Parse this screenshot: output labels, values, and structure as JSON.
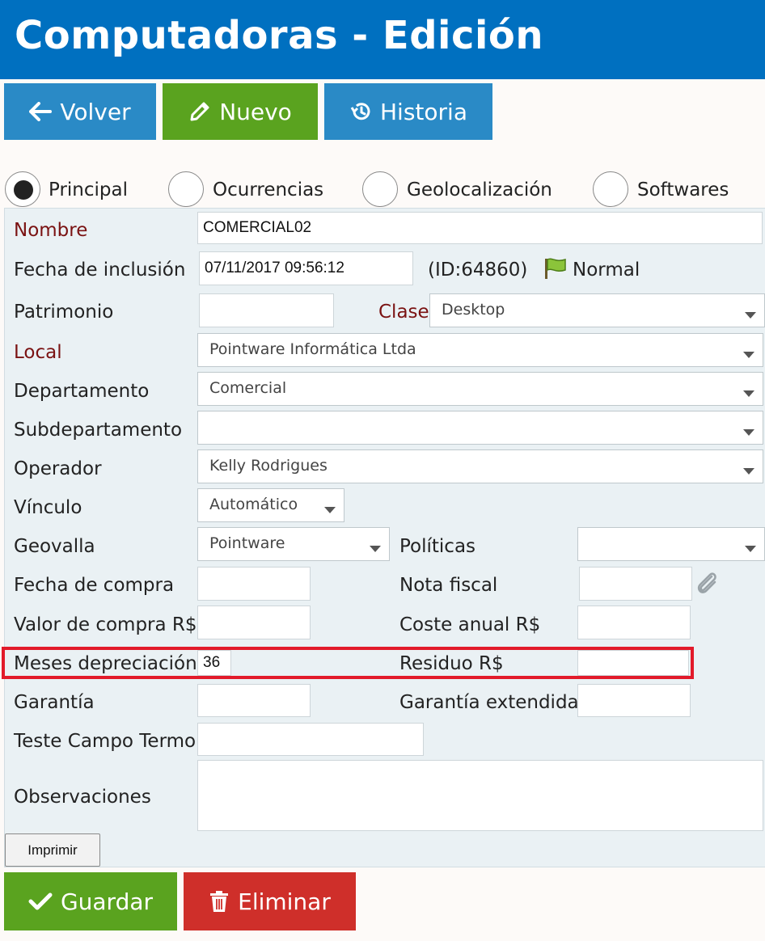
{
  "header": {
    "title": "Computadoras - Edición"
  },
  "toolbar": {
    "back_label": "Volver",
    "new_label": "Nuevo",
    "history_label": "Historia"
  },
  "tabs": [
    {
      "label": "Principal",
      "selected": true
    },
    {
      "label": "Ocurrencias",
      "selected": false
    },
    {
      "label": "Geolocalización",
      "selected": false
    },
    {
      "label": "Softwares",
      "selected": false
    }
  ],
  "form": {
    "nombre": {
      "label": "Nombre",
      "value": "COMERCIAL02"
    },
    "fecha_inclusion": {
      "label": "Fecha de inclusión",
      "value": "07/11/2017 09:56:12"
    },
    "record_id": "(ID:64860)",
    "status": {
      "label": "Normal",
      "flag_icon": "green-flag-icon"
    },
    "patrimonio": {
      "label": "Patrimonio",
      "value": ""
    },
    "clase": {
      "label": "Clase",
      "value": "Desktop"
    },
    "local": {
      "label": "Local",
      "value": "Pointware Informática Ltda"
    },
    "departamento": {
      "label": "Departamento",
      "value": "Comercial"
    },
    "subdepartamento": {
      "label": "Subdepartamento",
      "value": ""
    },
    "operador": {
      "label": "Operador",
      "value": "Kelly Rodrigues"
    },
    "vinculo": {
      "label": "Vínculo",
      "value": "Automático"
    },
    "geovalla": {
      "label": "Geovalla",
      "value": "Pointware"
    },
    "politicas": {
      "label": "Políticas",
      "value": ""
    },
    "fecha_compra": {
      "label": "Fecha de compra",
      "value": ""
    },
    "nota_fiscal": {
      "label": "Nota fiscal",
      "value": ""
    },
    "valor_compra": {
      "label": "Valor de compra R$",
      "value": ""
    },
    "coste_anual": {
      "label": "Coste anual R$",
      "value": ""
    },
    "meses_depreciacion": {
      "label": "Meses depreciación",
      "value": "36"
    },
    "residuo": {
      "label": "Residuo R$",
      "value": ""
    },
    "garantia": {
      "label": "Garantía",
      "value": ""
    },
    "garantia_extendida": {
      "label": "Garantía extendida",
      "value": ""
    },
    "teste_campo": {
      "label": "Teste Campo Termo",
      "value": ""
    },
    "observaciones": {
      "label": "Observaciones",
      "value": ""
    }
  },
  "print_label": "Imprimir",
  "footer": {
    "save_label": "Guardar",
    "delete_label": "Eliminar"
  },
  "colors": {
    "header": "#0070c0",
    "blue_button": "#2a8ac6",
    "green_button": "#5aa31f",
    "red_button": "#cf2f2a",
    "required_label": "#7a1212",
    "highlight": "#e21a2a"
  }
}
